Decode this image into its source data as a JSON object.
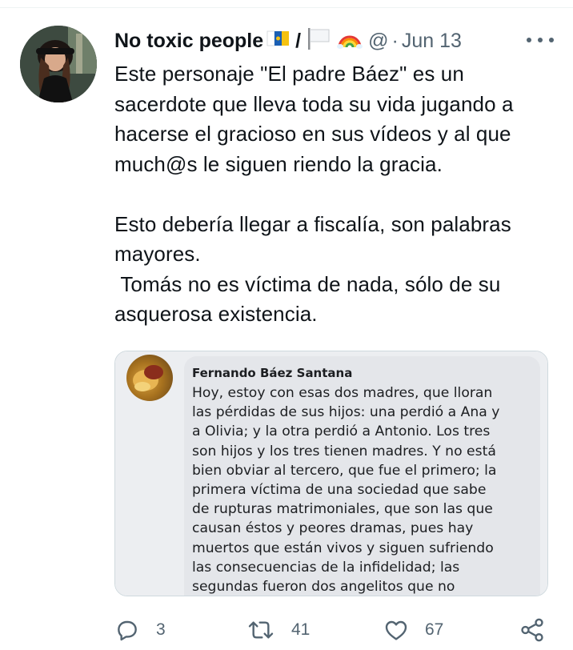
{
  "tweet": {
    "author_name": "No toxic people",
    "author_separator": "/",
    "handle": "@",
    "dot": "·",
    "date": "Jun 13",
    "text": "Este personaje \"El padre Báez\" es un sacerdote que lleva toda su vida jugando a hacerse el gracioso en sus vídeos y al que much@s le siguen riendo la gracia.\n\nEsto debería llegar a fiscalía, son palabras mayores.\n Tomás no es víctima de nada, sólo de su asquerosa existencia."
  },
  "media": {
    "fb_author": "Fernando Báez Santana",
    "fb_text": "Hoy, estoy con esas dos madres, que lloran\nlas pérdidas de sus hijos: una perdió a Ana y\na Olivia; y la otra perdió a Antonio. Los tres\nson hijos y los tres tienen madres. Y no está\nbien obviar al tercero, que fue el primero; la\nprimera víctima de una sociedad que sabe\nde rupturas matrimoniales, que son las que\ncausan éstos y peores dramas, pues hay\nmuertos que están vivos y siguen sufriendo\nlas consecuencias de la infidelidad; las\nsegundas fueron dos angelitos que no"
  },
  "actions": {
    "replies": "3",
    "retweets": "41",
    "likes": "67"
  },
  "icons": {
    "more": "more-icon",
    "reply": "reply-icon",
    "retweet": "retweet-icon",
    "like": "heart-icon",
    "share": "share-icon"
  },
  "colors": {
    "text": "#0f1419",
    "secondary": "#536471",
    "border": "#cfd9de"
  }
}
